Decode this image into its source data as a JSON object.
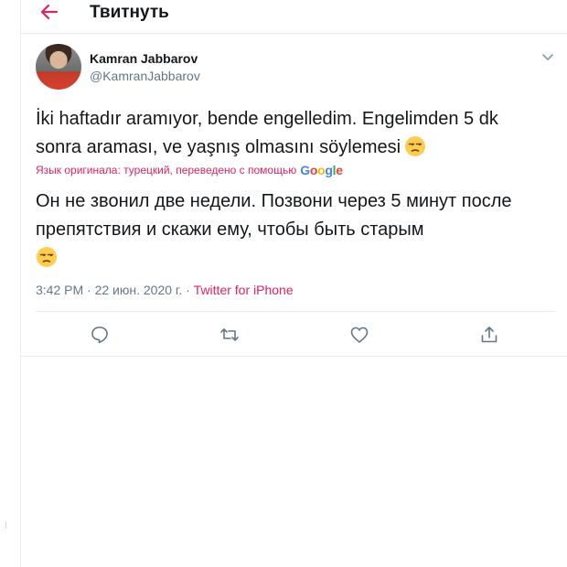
{
  "header": {
    "title": "Твитнуть",
    "back_icon": "arrow-left-icon",
    "accent": "#e0245e"
  },
  "tweet": {
    "author_name": "Kamran Jabbarov",
    "author_handle": "@KamranJabbarov",
    "text": "İki haftadır aramıyor, bende engelledim. Engelimden 5 dk sonra araması, ve yaşnış olmasını söylemesi",
    "emoji": "unamused-face-icon",
    "translation_label": "Язык оригинала: турецкий, переведено с помощью",
    "translation_provider": "Google",
    "translated_text": "Он не звонил две недели. Позвони через 5 минут после препятствия и скажи ему, чтобы быть старым",
    "time": "3:42 PM",
    "date": "22 июн. 2020 г.",
    "separator": "·",
    "source": "Twitter for iPhone"
  },
  "actions": [
    {
      "name": "reply-icon"
    },
    {
      "name": "retweet-icon"
    },
    {
      "name": "like-icon"
    },
    {
      "name": "share-icon"
    }
  ],
  "colors": {
    "text": "#14171a",
    "secondary": "#657786",
    "accent": "#e0245e",
    "border": "#e6ecf0"
  }
}
